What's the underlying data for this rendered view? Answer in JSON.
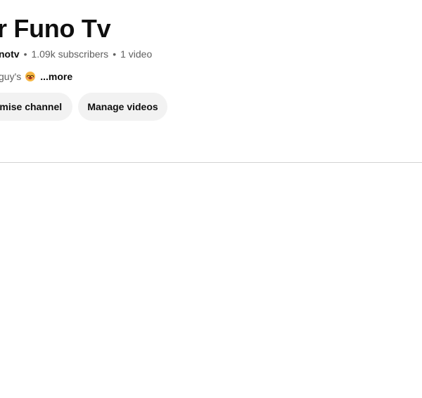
{
  "channel": {
    "title": "r Funo Tv",
    "handle": "notv",
    "subscribers": "1.09k subscribers",
    "videos": "1 video",
    "separator": "•"
  },
  "description": {
    "text": "guy's",
    "emoji": "smiling-face-emoji",
    "more_label": "...more"
  },
  "actions": {
    "customise_label": "omise channel",
    "manage_label": "Manage videos"
  },
  "colors": {
    "title": "#0f0f0f",
    "muted_text": "#606060",
    "pill_background": "#f2f2f2",
    "divider": "#d3d3d3"
  }
}
